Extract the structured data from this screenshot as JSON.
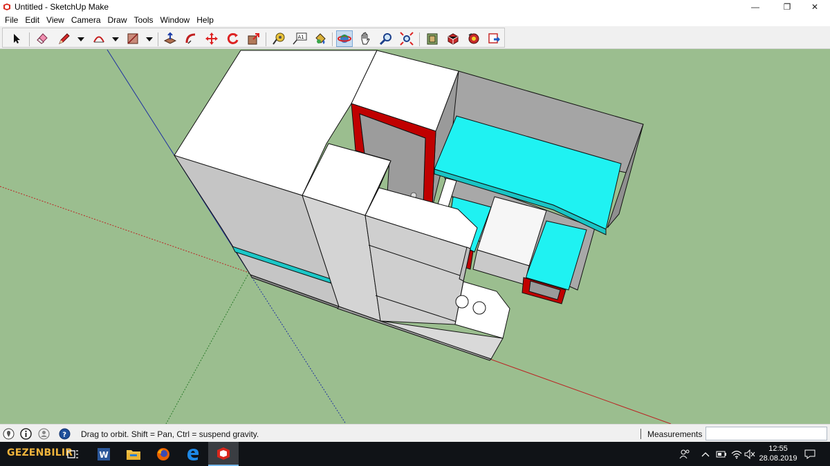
{
  "window": {
    "title": "Untitled - SketchUp Make",
    "controls": {
      "minimize": "—",
      "maximize": "❐",
      "close": "✕"
    }
  },
  "menu": [
    "File",
    "Edit",
    "View",
    "Camera",
    "Draw",
    "Tools",
    "Window",
    "Help"
  ],
  "toolbar": {
    "tools": [
      "select-tool",
      "eraser-tool",
      "pencil-line-tool",
      "arc-tool",
      "rectangle-tool",
      "push-pull-tool",
      "follow-me-tool",
      "move-tool",
      "rotate-tool",
      "scale-tool",
      "tape-measure-tool",
      "text-tool",
      "paint-bucket-tool",
      "orbit-tool",
      "pan-tool",
      "zoom-tool",
      "zoom-extents-tool",
      "3d-warehouse-tool",
      "extension-warehouse-tool",
      "layout-tool",
      "send-to-layout-tool"
    ],
    "active_tool": "orbit-tool"
  },
  "status": {
    "hint": "Drag to orbit. Shift = Pan, Ctrl = suspend gravity.",
    "measurements_label": "Measurements",
    "measurements_value": ""
  },
  "taskbar": {
    "brand": "GEZENBILIR",
    "apps": [
      "task-view",
      "word",
      "file-explorer",
      "firefox",
      "edge",
      "sketchup"
    ],
    "active_app": "sketchup",
    "clock_time": "12:55",
    "clock_date": "28.08.2019"
  },
  "colors": {
    "canvas_bg": "#9bbe8f",
    "accent_red": "#c00000",
    "accent_cyan": "#00ffff",
    "face_white": "#ffffff",
    "face_grey": "#c4c4c4"
  }
}
